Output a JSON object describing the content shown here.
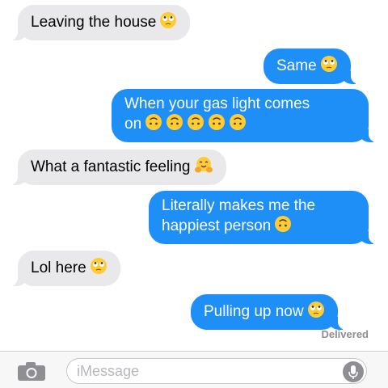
{
  "messages": [
    {
      "direction": "incoming",
      "text": "Leaving the house",
      "emojis": [
        "rolling-eyes-emoji"
      ]
    },
    {
      "direction": "outgoing",
      "text": "Same",
      "emojis": [
        "rolling-eyes-emoji"
      ]
    },
    {
      "direction": "outgoing",
      "text_line1": "When your gas light comes",
      "text_line2": "on",
      "emojis": [
        "upside-down-face-emoji",
        "upside-down-face-emoji",
        "upside-down-face-emoji",
        "upside-down-face-emoji",
        "upside-down-face-emoji"
      ]
    },
    {
      "direction": "incoming",
      "text": "What a fantastic feeling",
      "emojis": [
        "hugging-face-emoji"
      ]
    },
    {
      "direction": "outgoing",
      "text_line1": "Literally makes me the",
      "text_line2": "happiest person",
      "emojis": [
        "upside-down-face-emoji"
      ]
    },
    {
      "direction": "incoming",
      "text": "Lol here",
      "emojis": [
        "rolling-eyes-emoji"
      ]
    },
    {
      "direction": "outgoing",
      "text": "Pulling up now",
      "emojis": [
        "rolling-eyes-emoji"
      ]
    }
  ],
  "status": "Delivered",
  "composer": {
    "placeholder": "iMessage"
  },
  "icons": {
    "camera": "camera-icon",
    "microphone": "microphone-icon"
  },
  "colors": {
    "outgoing_bubble": "#1e8ff6",
    "incoming_bubble": "#e9e9eb"
  }
}
